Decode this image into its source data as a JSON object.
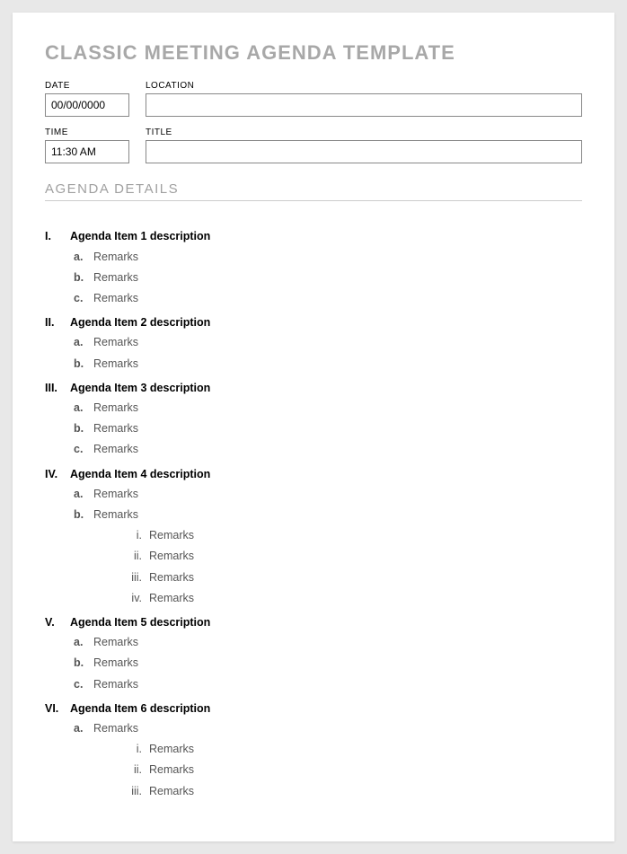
{
  "title": "CLASSIC MEETING AGENDA TEMPLATE",
  "fields": {
    "date": {
      "label": "DATE",
      "value": "00/00/0000"
    },
    "location": {
      "label": "LOCATION",
      "value": ""
    },
    "time": {
      "label": "TIME",
      "value": "11:30 AM"
    },
    "title": {
      "label": "TITLE",
      "value": ""
    }
  },
  "section_title": "AGENDA DETAILS",
  "agenda_items": [
    {
      "num": "I.",
      "label": "Agenda Item 1 description",
      "remarks": [
        {
          "num": "a.",
          "text": "Remarks"
        },
        {
          "num": "b.",
          "text": "Remarks"
        },
        {
          "num": "c.",
          "text": "Remarks"
        }
      ]
    },
    {
      "num": "II.",
      "label": "Agenda Item 2 description",
      "remarks": [
        {
          "num": "a.",
          "text": "Remarks"
        },
        {
          "num": "b.",
          "text": "Remarks"
        }
      ]
    },
    {
      "num": "III.",
      "label": "Agenda Item 3 description",
      "remarks": [
        {
          "num": "a.",
          "text": "Remarks"
        },
        {
          "num": "b.",
          "text": "Remarks"
        },
        {
          "num": "c.",
          "text": "Remarks"
        }
      ]
    },
    {
      "num": "IV.",
      "label": "Agenda Item 4 description",
      "remarks": [
        {
          "num": "a.",
          "text": "Remarks"
        },
        {
          "num": "b.",
          "text": "Remarks",
          "sub": [
            {
              "num": "i.",
              "text": "Remarks"
            },
            {
              "num": "ii.",
              "text": "Remarks"
            },
            {
              "num": "iii.",
              "text": "Remarks"
            },
            {
              "num": "iv.",
              "text": "Remarks"
            }
          ]
        }
      ]
    },
    {
      "num": "V.",
      "label": "Agenda Item 5 description",
      "remarks": [
        {
          "num": "a.",
          "text": "Remarks"
        },
        {
          "num": "b.",
          "text": "Remarks"
        },
        {
          "num": "c.",
          "text": "Remarks"
        }
      ]
    },
    {
      "num": "VI.",
      "label": "Agenda Item 6 description",
      "remarks": [
        {
          "num": "a.",
          "text": "Remarks",
          "sub": [
            {
              "num": "i.",
              "text": "Remarks"
            },
            {
              "num": "ii.",
              "text": "Remarks"
            },
            {
              "num": "iii.",
              "text": "Remarks"
            }
          ]
        }
      ]
    }
  ]
}
